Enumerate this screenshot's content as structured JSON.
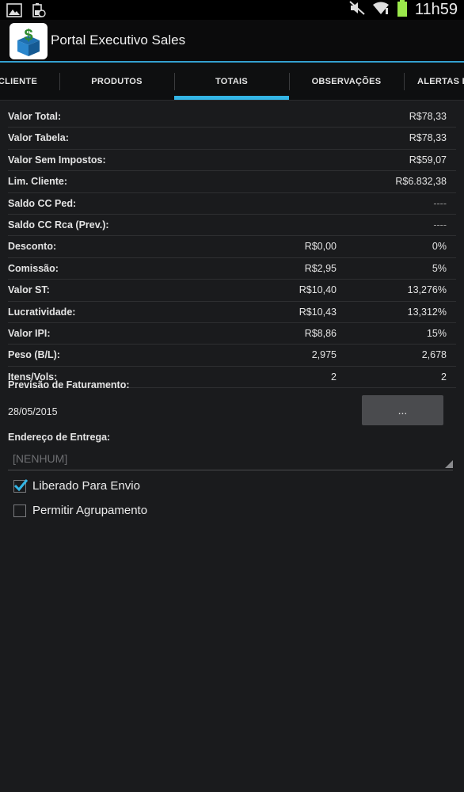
{
  "status_bar": {
    "time": "11h59",
    "icons": [
      "gallery-icon",
      "battery-usb-icon",
      "mute-icon",
      "wifi-icon",
      "battery-icon"
    ],
    "battery_color": "#9be84b"
  },
  "app": {
    "title": "Portal Executivo Sales",
    "icon": "money-box-icon"
  },
  "tabs": [
    {
      "label": "CLIENTE",
      "active": false
    },
    {
      "label": "PRODUTOS",
      "active": false
    },
    {
      "label": "TOTAIS",
      "active": true
    },
    {
      "label": "OBSERVAÇÕES",
      "active": false
    },
    {
      "label": "ALERTAS D",
      "active": false
    }
  ],
  "totals": [
    {
      "label": "Valor Total:",
      "value1": "",
      "value2": "R$78,33"
    },
    {
      "label": "Valor Tabela:",
      "value1": "",
      "value2": "R$78,33"
    },
    {
      "label": "Valor Sem Impostos:",
      "value1": "",
      "value2": "R$59,07"
    },
    {
      "label": "Lim. Cliente:",
      "value1": "",
      "value2": "R$6.832,38"
    },
    {
      "label": "Saldo CC Ped:",
      "value1": "",
      "value2": "----"
    },
    {
      "label": "Saldo CC Rca (Prev.):",
      "value1": "",
      "value2": "----"
    },
    {
      "label": "Desconto:",
      "value1": "R$0,00",
      "value2": "0%"
    },
    {
      "label": "Comissão:",
      "value1": "R$2,95",
      "value2": "5%"
    },
    {
      "label": "Valor ST:",
      "value1": "R$10,40",
      "value2": "13,276%"
    },
    {
      "label": "Lucratividade:",
      "value1": "R$10,43",
      "value2": "13,312%"
    },
    {
      "label": "Valor IPI:",
      "value1": "R$8,86",
      "value2": "15%"
    },
    {
      "label": "Peso (B/L):",
      "value1": "2,975",
      "value2": "2,678"
    },
    {
      "label": "Itens/Vols:",
      "value1": "2",
      "value2": "2"
    }
  ],
  "billing": {
    "label": "Previsão de Faturamento:",
    "date": "28/05/2015",
    "picker_label": "..."
  },
  "delivery": {
    "label": "Endereço de Entrega:",
    "selected": "[NENHUM]"
  },
  "options": [
    {
      "label": "Liberado Para Envio",
      "checked": true
    },
    {
      "label": "Permitir Agrupamento",
      "checked": false
    }
  ],
  "accent_color": "#33b5e5"
}
